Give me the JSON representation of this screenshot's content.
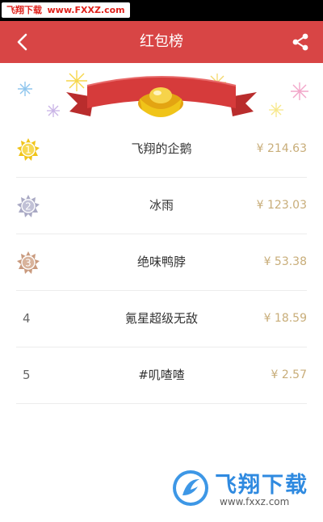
{
  "watermark_top": {
    "brand": "飞翔下载",
    "url": "www.FXXZ.com"
  },
  "header": {
    "title": "红包榜"
  },
  "icons": {
    "back": "back-arrow-icon",
    "share": "share-icon"
  },
  "colors": {
    "header_bg": "#d84545",
    "amount": "#c8ad79",
    "ribbon": "#d63b3b",
    "gold": "#f0c419",
    "silver": "#a9a9c4",
    "bronze": "#c99a7e"
  },
  "ranking": [
    {
      "rank": "1",
      "badge": "gold",
      "name": "飞翔的企鹅",
      "amount": "¥ 214.63"
    },
    {
      "rank": "2",
      "badge": "silver",
      "name": "冰雨",
      "amount": "¥ 123.03"
    },
    {
      "rank": "3",
      "badge": "bronze",
      "name": "绝味鸭脖",
      "amount": "¥ 53.38"
    },
    {
      "rank": "4",
      "badge": "",
      "name": "氪星超级无敌",
      "amount": "¥ 18.59"
    },
    {
      "rank": "5",
      "badge": "",
      "name": "#叽喳喳",
      "amount": "¥ 2.57"
    }
  ],
  "watermark_bottom": {
    "brand": "飞翔下载",
    "url": "www.fxxz.com"
  }
}
